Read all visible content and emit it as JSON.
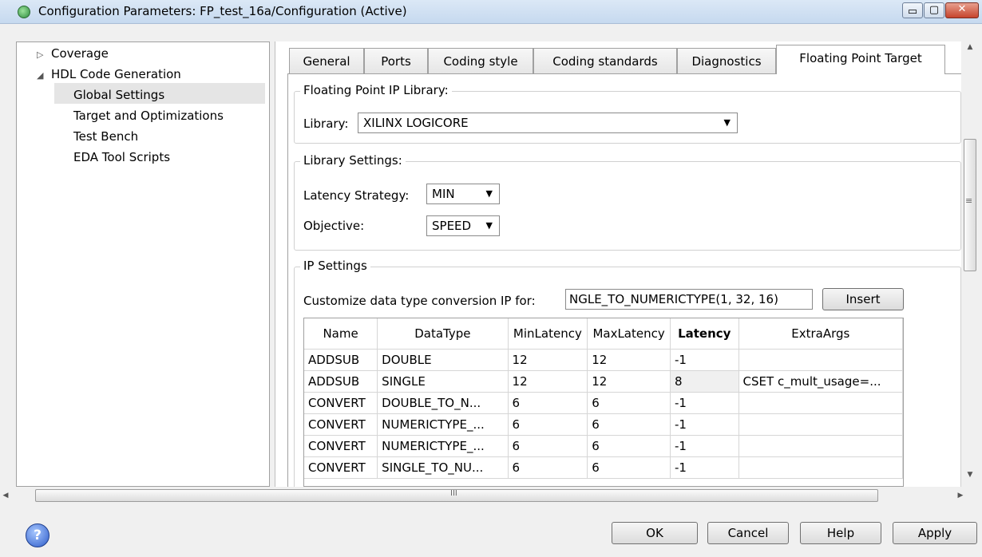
{
  "window": {
    "title": "Configuration Parameters: FP_test_16a/Configuration (Active)",
    "minimize_glyph": "▭",
    "maximize_glyph": "▢",
    "close_glyph": "✕"
  },
  "tree": {
    "items": [
      {
        "label": "Coverage",
        "arrow": "▷"
      },
      {
        "label": "HDL Code Generation",
        "arrow": "◢"
      },
      {
        "label": "Global Settings",
        "selected": true
      },
      {
        "label": "Target and Optimizations"
      },
      {
        "label": "Test Bench"
      },
      {
        "label": "EDA Tool Scripts"
      }
    ]
  },
  "tabs": [
    {
      "label": "General"
    },
    {
      "label": "Ports"
    },
    {
      "label": "Coding style"
    },
    {
      "label": "Coding standards"
    },
    {
      "label": "Diagnostics"
    },
    {
      "label": "Floating Point Target",
      "active": true
    }
  ],
  "ip_library": {
    "group_title": "Floating Point IP Library:",
    "library_label": "Library:",
    "library_value": "XILINX LOGICORE"
  },
  "library_settings": {
    "group_title": "Library Settings:",
    "latency_label": "Latency Strategy:",
    "latency_value": "MIN",
    "objective_label": "Objective:",
    "objective_value": "SPEED"
  },
  "ip_settings": {
    "group_title": "IP Settings",
    "customize_label": "Customize data type conversion IP for:",
    "customize_value": "NGLE_TO_NUMERICTYPE(1, 32, 16)",
    "insert_label": "Insert"
  },
  "table": {
    "headers": [
      "Name",
      "DataType",
      "MinLatency",
      "MaxLatency",
      "Latency",
      "ExtraArgs"
    ],
    "rows": [
      [
        "ADDSUB",
        "DOUBLE",
        "12",
        "12",
        "-1",
        ""
      ],
      [
        "ADDSUB",
        "SINGLE",
        "12",
        "12",
        "8",
        "CSET c_mult_usage=..."
      ],
      [
        "CONVERT",
        "DOUBLE_TO_N...",
        "6",
        "6",
        "-1",
        ""
      ],
      [
        "CONVERT",
        "NUMERICTYPE_...",
        "6",
        "6",
        "-1",
        ""
      ],
      [
        "CONVERT",
        "NUMERICTYPE_...",
        "6",
        "6",
        "-1",
        ""
      ],
      [
        "CONVERT",
        "SINGLE_TO_NU...",
        "6",
        "6",
        "-1",
        ""
      ]
    ]
  },
  "scroll": {
    "hgrip": "III",
    "vgrip": "≡",
    "left_arrow": "◀",
    "right_arrow": "▶",
    "up_arrow": "▲",
    "down_arrow": "▼"
  },
  "footer": {
    "help_glyph": "?",
    "ok": "OK",
    "cancel": "Cancel",
    "help": "Help",
    "apply": "Apply"
  }
}
